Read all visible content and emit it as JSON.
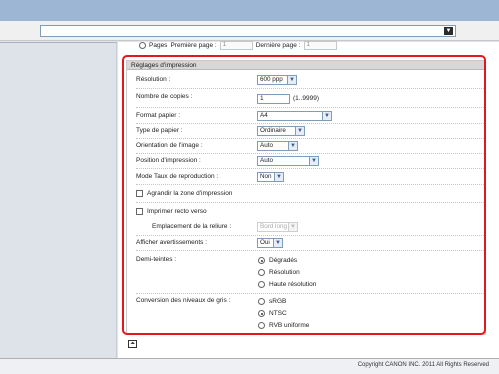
{
  "pages": {
    "label": "Pages",
    "first_label": "Première page :",
    "first_value": "1",
    "last_label": "Dernière page :",
    "last_value": "1"
  },
  "section": {
    "title": "Réglages d'impression"
  },
  "fields": {
    "resolution": {
      "label": "Résolution :",
      "value": "600 ppp"
    },
    "copies": {
      "label": "Nombre de copies :",
      "value": "1",
      "range": "(1..9999)"
    },
    "paper_size": {
      "label": "Format papier :",
      "value": "A4"
    },
    "paper_type": {
      "label": "Type de papier :",
      "value": "Ordinaire"
    },
    "orientation": {
      "label": "Orientation de l'image :",
      "value": "Auto"
    },
    "print_position": {
      "label": "Position d'impression :",
      "value": "Auto"
    },
    "reproduction_ratio": {
      "label": "Mode Taux de reproduction :",
      "value": "Non"
    },
    "enlarge_area": {
      "label": "Agrandir la zone d'impression",
      "checked": false
    },
    "duplex": {
      "label": "Imprimer recto verso",
      "checked": false
    },
    "binding": {
      "label": "Emplacement de la reliure :",
      "value": "Bord long"
    },
    "warnings": {
      "label": "Afficher avertissements :",
      "value": "Oui"
    },
    "halftones": {
      "label": "Demi-teintes :",
      "options": [
        "Dégradés",
        "Résolution",
        "Haute résolution"
      ],
      "selected": "Dégradés"
    },
    "grayscale": {
      "label": "Conversion des niveaux de gris :",
      "options": [
        "sRGB",
        "NTSC",
        "RVB uniforme"
      ],
      "selected": "NTSC"
    }
  },
  "footer": {
    "copyright": "Copyright CANON INC. 2011 All Rights Reserved"
  },
  "colors": {
    "highlight": "#e3171e",
    "topbar": "#9db6d4"
  },
  "icons": {
    "dropdown": "chevron-down-icon",
    "scroll": "scroll-icon"
  }
}
